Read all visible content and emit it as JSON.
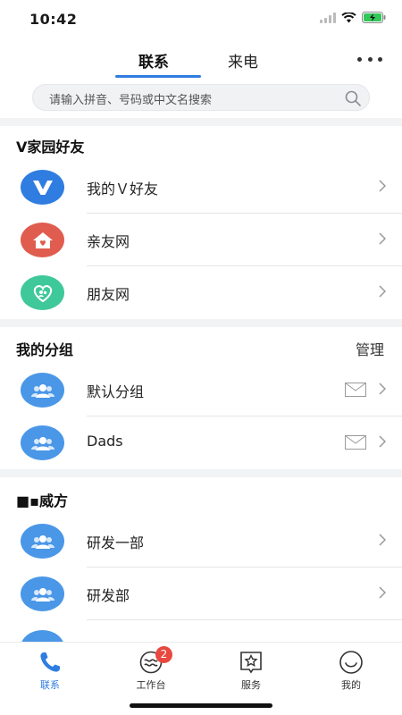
{
  "status_bar": {
    "time": "10:42"
  },
  "tabs": [
    {
      "label": "联系",
      "active": true
    },
    {
      "label": "来电",
      "active": false
    }
  ],
  "search": {
    "placeholder": "请输入拼音、号码或中文名搜索"
  },
  "sections": {
    "vfriends": {
      "title": "V家园好友",
      "items": [
        {
          "label": "我的Ｖ好友",
          "icon": "v-logo-icon",
          "color": "#2f7de1"
        },
        {
          "label": "亲友网",
          "icon": "house-heart-icon",
          "color": "#e05c4f"
        },
        {
          "label": "朋友网",
          "icon": "friends-heart-icon",
          "color": "#3fc89a"
        }
      ]
    },
    "groups": {
      "title": "我的分组",
      "action": "管理",
      "items": [
        {
          "label": "默认分组",
          "icon": "group-icon",
          "color": "#4a97e8"
        },
        {
          "label": "Dads",
          "icon": "group-icon",
          "color": "#4a97e8"
        }
      ]
    },
    "org": {
      "title": "■▪威方",
      "items": [
        {
          "label": "研发一部",
          "icon": "group-icon"
        },
        {
          "label": "研发部",
          "icon": "group-icon"
        }
      ]
    }
  },
  "bottom_nav": [
    {
      "label": "联系",
      "icon": "phone-icon",
      "active": true
    },
    {
      "label": "工作台",
      "icon": "workbench-icon",
      "badge": "2"
    },
    {
      "label": "服务",
      "icon": "star-bookmark-icon"
    },
    {
      "label": "我的",
      "icon": "smile-icon"
    }
  ],
  "colors": {
    "accent": "#2f7de1",
    "badge": "#e8483f"
  }
}
